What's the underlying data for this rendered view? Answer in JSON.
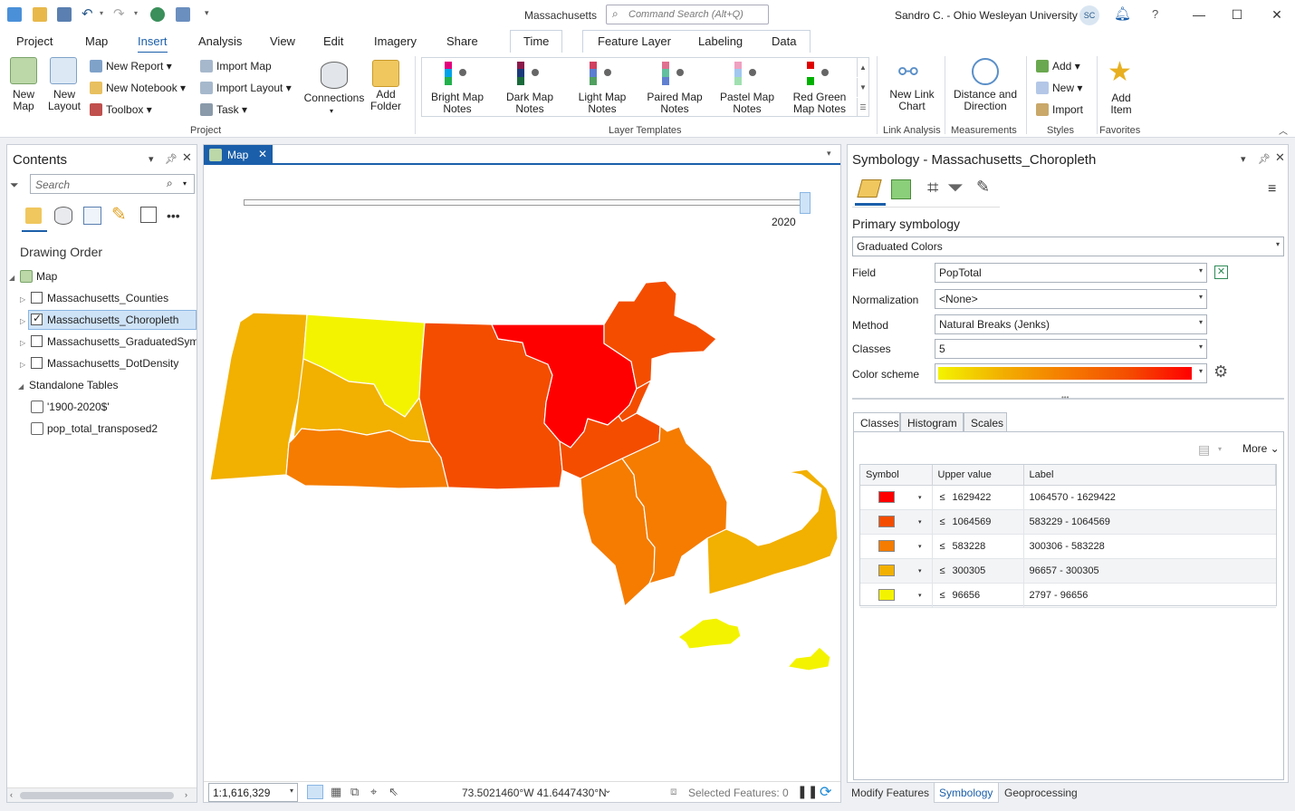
{
  "window": {
    "title": "Massachusetts",
    "search_placeholder": "Command Search (Alt+Q)",
    "user": "Sandro C. - Ohio Wesleyan University",
    "avatar_initials": "SC"
  },
  "tabs": [
    "Project",
    "Map",
    "Insert",
    "Analysis",
    "View",
    "Edit",
    "Imagery",
    "Share",
    "Time",
    "Feature Layer",
    "Labeling",
    "Data"
  ],
  "active_tab": "Insert",
  "ribbon": {
    "new_map": "New Map",
    "new_layout": "New Layout",
    "new_report": "New Report",
    "new_notebook": "New Notebook",
    "toolbox": "Toolbox",
    "import_map": "Import Map",
    "import_layout": "Import Layout",
    "task": "Task",
    "connections": "Connections",
    "add_folder": "Add Folder",
    "group_project": "Project",
    "templates": [
      "Bright Map Notes",
      "Dark Map Notes",
      "Light Map Notes",
      "Paired Map Notes",
      "Pastel Map Notes",
      "Red Green Map Notes"
    ],
    "group_layer_templates": "Layer Templates",
    "new_link_chart": "New Link Chart",
    "group_link_analysis": "Link Analysis",
    "distance_direction": "Distance and Direction",
    "group_measurements": "Measurements",
    "styles_add": "Add",
    "styles_new": "New",
    "styles_import": "Import",
    "group_styles": "Styles",
    "add_item": "Add Item",
    "group_favorites": "Favorites"
  },
  "contents": {
    "title": "Contents",
    "search_placeholder": "Search",
    "drawing_order": "Drawing Order",
    "map_node": "Map",
    "layers": [
      {
        "name": "Massachusetts_Counties",
        "checked": false
      },
      {
        "name": "Massachusetts_Choropleth",
        "checked": true
      },
      {
        "name": "Massachusetts_GraduatedSymb",
        "checked": false
      },
      {
        "name": "Massachusetts_DotDensity",
        "checked": false
      }
    ],
    "standalone_tables": "Standalone Tables",
    "tables": [
      "'1900-2020$'",
      "pop_total_transposed2"
    ]
  },
  "map": {
    "tab_label": "Map",
    "time_label": "2020",
    "time_position": 1.0,
    "scale": "1:1,616,329",
    "coords": "73.5021460°W 41.6447430°N",
    "selected_features": "Selected Features: 0"
  },
  "symbology": {
    "title": "Symbology - Massachusetts_Choropleth",
    "primary_symbology": "Primary symbology",
    "renderer": "Graduated Colors",
    "field_label": "Field",
    "field_value": "PopTotal",
    "normalization_label": "Normalization",
    "normalization_value": "<None>",
    "method_label": "Method",
    "method_value": "Natural Breaks (Jenks)",
    "classes_label": "Classes",
    "classes_value": "5",
    "color_scheme_label": "Color scheme",
    "subtabs": [
      "Classes",
      "Histogram",
      "Scales"
    ],
    "more": "More",
    "columns": [
      "Symbol",
      "Upper value",
      "Label"
    ],
    "le": "≤",
    "rows": [
      {
        "color": "#ff0000",
        "upper": "1629422",
        "label": "1064570 - 1629422"
      },
      {
        "color": "#f44d00",
        "upper": "1064569",
        "label": "583229 - 1064569"
      },
      {
        "color": "#f57c00",
        "upper": "583228",
        "label": "300306 - 583228"
      },
      {
        "color": "#f2b000",
        "upper": "300305",
        "label": "96657 - 300305"
      },
      {
        "color": "#f3f300",
        "upper": "96656",
        "label": "2797 - 96656"
      }
    ]
  },
  "bottom_tabs": [
    "Modify Features",
    "Symbology",
    "Geoprocessing"
  ],
  "colors": {
    "accent": "#1b5faa",
    "class1": "#ff0000",
    "class2": "#f44d00",
    "class3": "#f57c00",
    "class4": "#f2b000",
    "class5": "#f3f300"
  }
}
